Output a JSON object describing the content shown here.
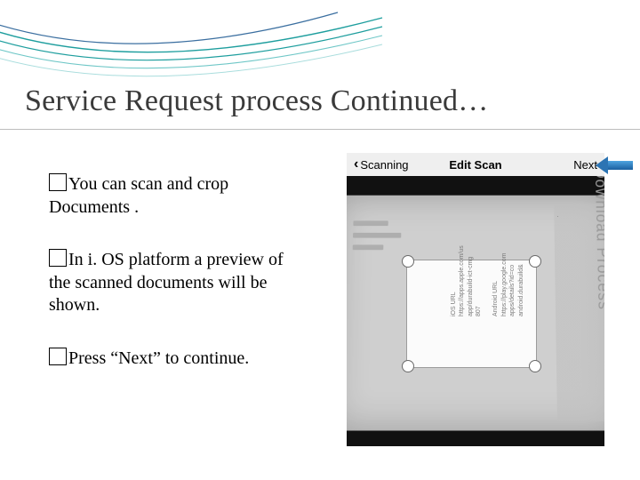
{
  "title": "Service Request process Continued…",
  "bullets": [
    "You can scan and crop Documents .",
    "In i. OS platform a preview of the scanned documents will be shown.",
    "Press “Next” to continue."
  ],
  "phone_bar": {
    "back_label": "Scanning",
    "center_label": "Edit Scan",
    "next_label": "Next"
  },
  "paper_side_text": "Download Process",
  "crop_preview_text": "iOS URL\nhttps://apps.apple.com/us\napp/durabuild-ict-cmg\n807\n\nAndroid URL\nhttps://play.google.com\napps/details?id=co\nandroid.durabuild&"
}
